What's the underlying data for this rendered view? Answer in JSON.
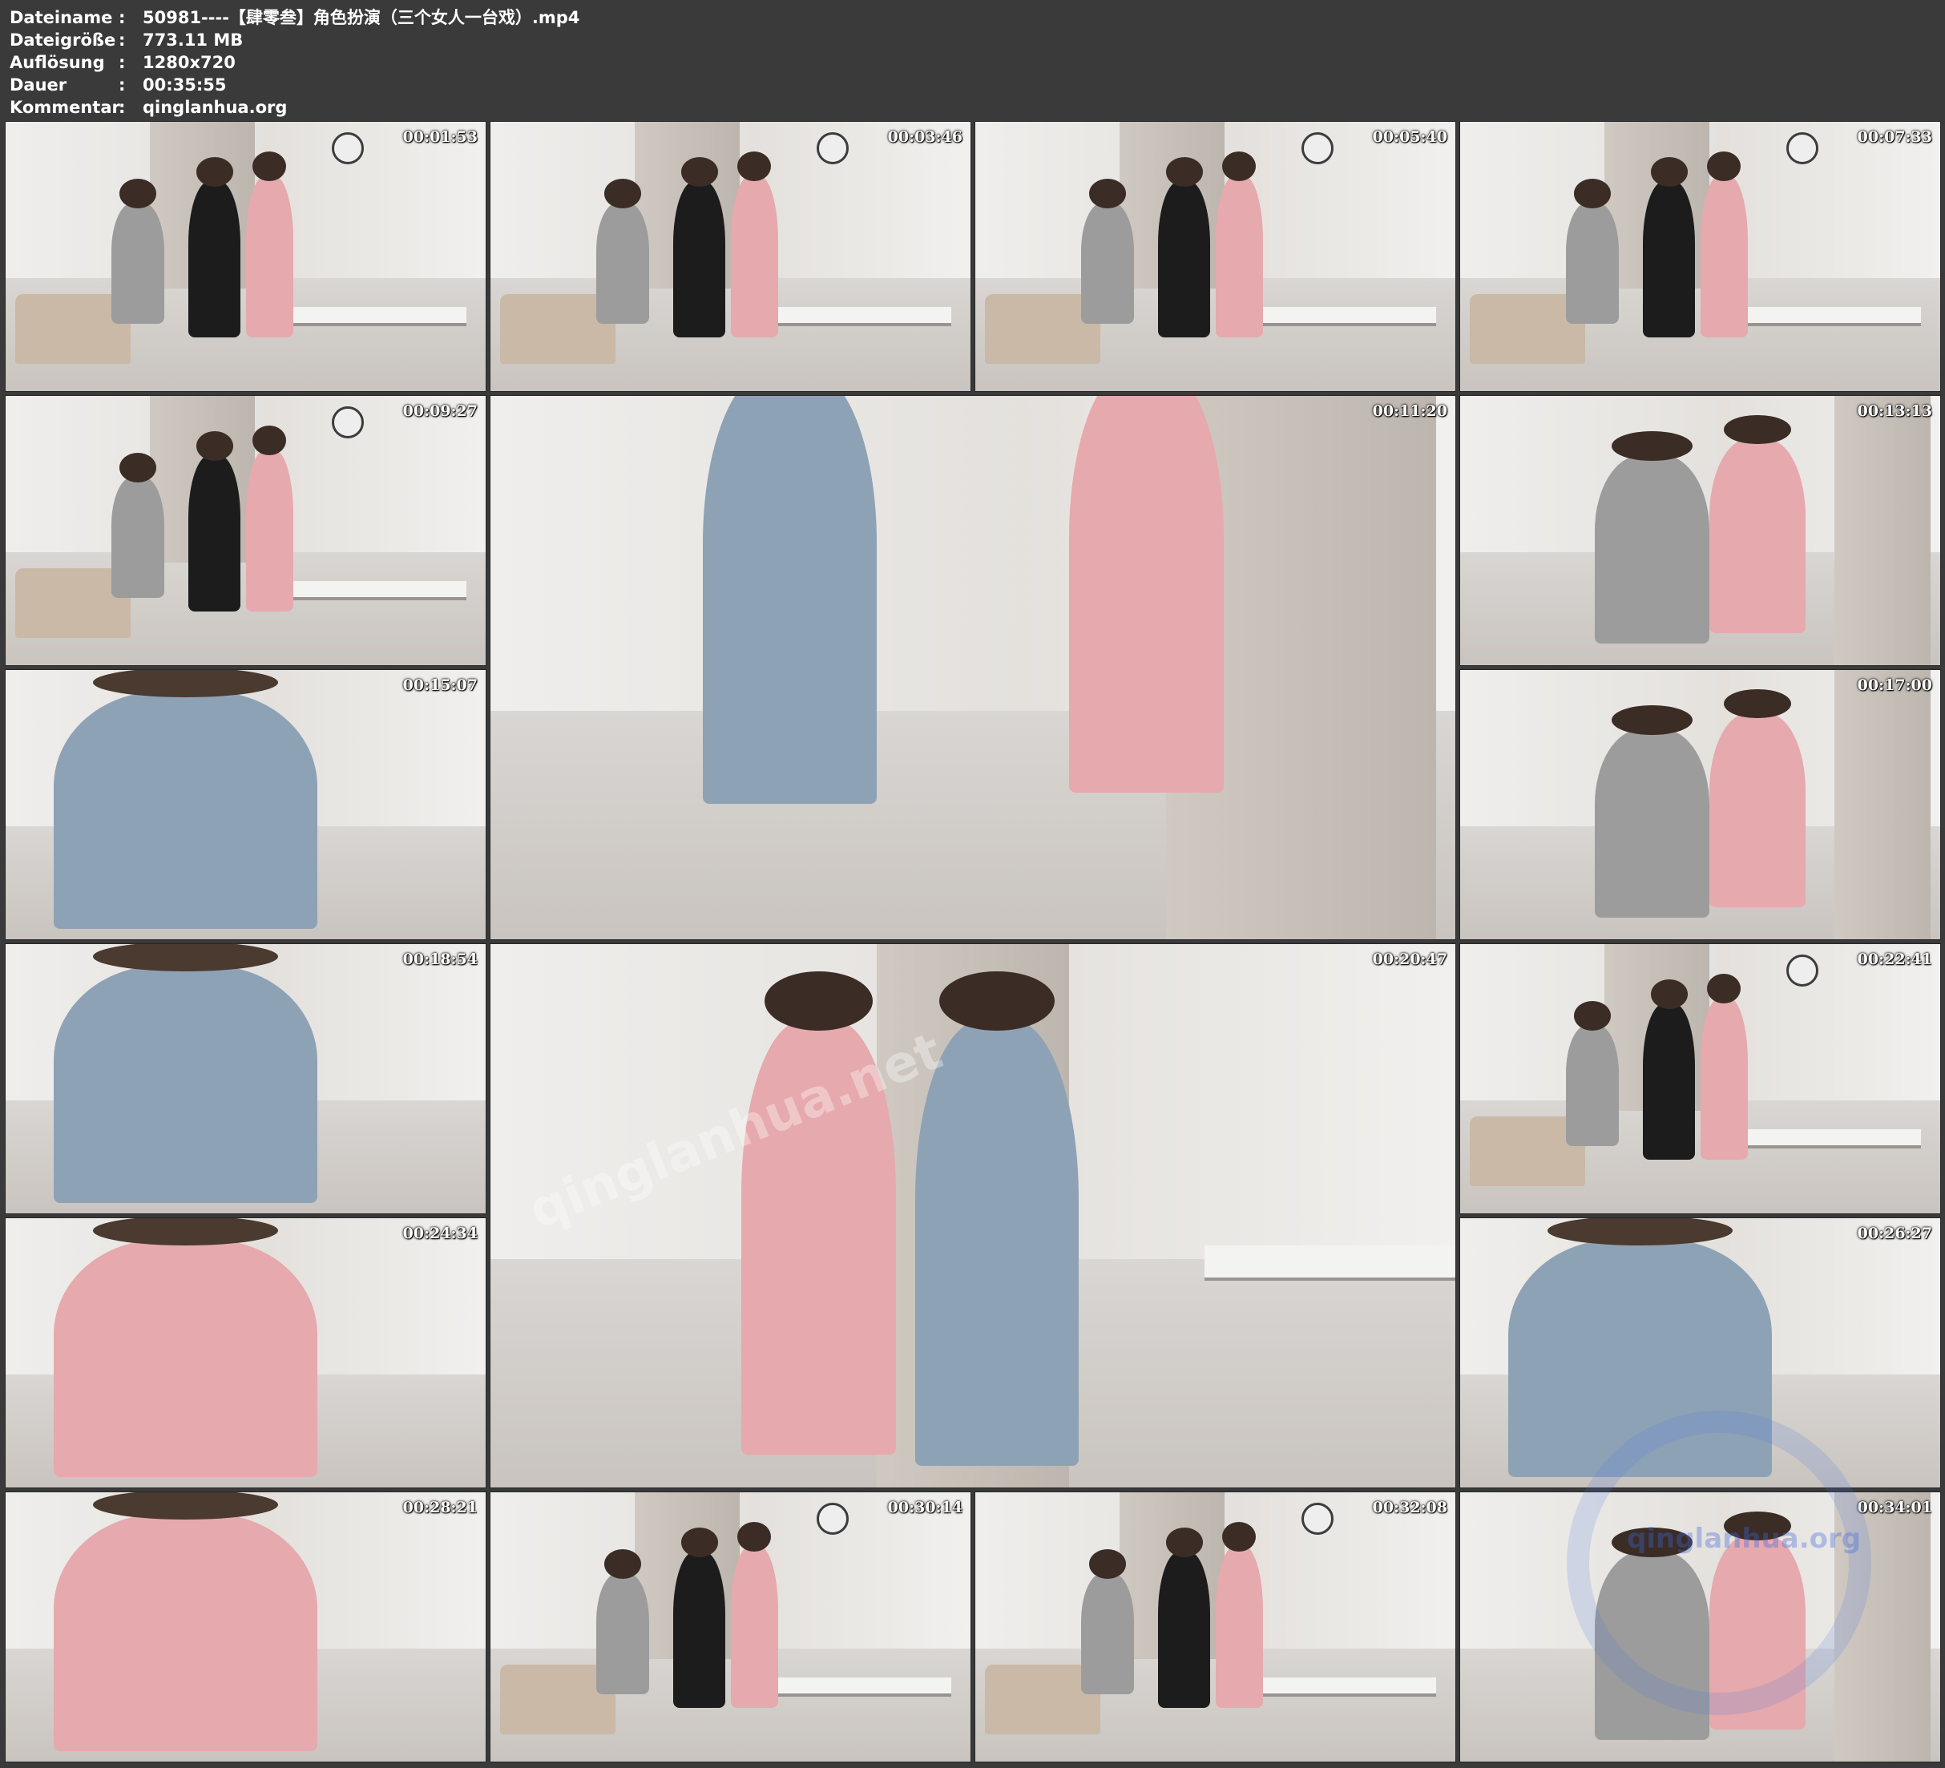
{
  "info": {
    "rows": [
      {
        "key": "Dateiname",
        "sep": ":",
        "value": "50981----【肆零叁】角色扮演（三个女人一台戏）.mp4"
      },
      {
        "key": "Dateigröße",
        "sep": ":",
        "value": "773.11 MB"
      },
      {
        "key": "Auflösung",
        "sep": ":",
        "value": "1280x720"
      },
      {
        "key": "Dauer",
        "sep": ":",
        "value": "00:35:55"
      },
      {
        "key": "Kommentar",
        "sep": ":",
        "value": "qinglanhua.org"
      }
    ]
  },
  "thumbnails": [
    {
      "timestamp": "00:01:53",
      "scene": "room-wide"
    },
    {
      "timestamp": "00:03:46",
      "scene": "room-wide"
    },
    {
      "timestamp": "00:05:40",
      "scene": "room-wide"
    },
    {
      "timestamp": "00:07:33",
      "scene": "room-wide"
    },
    {
      "timestamp": "00:09:27",
      "scene": "room-wide"
    },
    {
      "timestamp": "00:11:20",
      "scene": "feet-closeup"
    },
    {
      "timestamp": "00:13:13",
      "scene": "hallway"
    },
    {
      "timestamp": "00:15:07",
      "scene": "closeup"
    },
    {
      "timestamp": "00:17:00",
      "scene": "hallway"
    },
    {
      "timestamp": "00:18:54",
      "scene": "closeup"
    },
    {
      "timestamp": "00:20:47",
      "scene": "doorway-large"
    },
    {
      "timestamp": "00:22:41",
      "scene": "room-wide"
    },
    {
      "timestamp": "00:24:34",
      "scene": "closeup"
    },
    {
      "timestamp": "00:26:27",
      "scene": "closeup"
    },
    {
      "timestamp": "00:28:21",
      "scene": "closeup"
    },
    {
      "timestamp": "00:30:14",
      "scene": "room-wide"
    },
    {
      "timestamp": "00:32:08",
      "scene": "room-wide"
    },
    {
      "timestamp": "00:34:01",
      "scene": "hallway"
    }
  ],
  "watermarks": {
    "center": "qinglanhua.net",
    "corner": "qinglanhua.org"
  },
  "colors": {
    "background": "#3a3a3a",
    "text": "#ffffff",
    "pink_dress": "#e6a9ad",
    "black_dress": "#1c1c1c",
    "denim": "#8ea2b6",
    "gray_top": "#9c9c9c"
  }
}
